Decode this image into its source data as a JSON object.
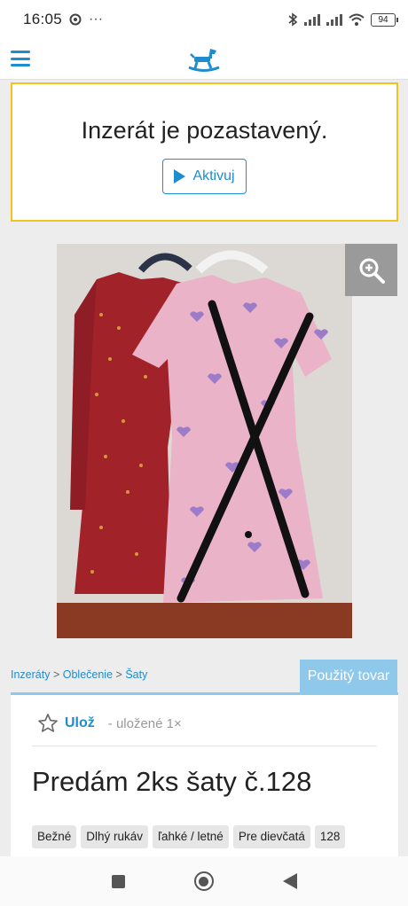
{
  "status": {
    "time": "16:05",
    "battery": "94"
  },
  "notice": {
    "title": "Inzerát je pozastavený.",
    "activate_label": "Aktivuj"
  },
  "breadcrumb": {
    "items": [
      "Inzeráty",
      "Oblečenie",
      "Šaty"
    ],
    "separator": ">"
  },
  "condition_tab": "Použitý tovar",
  "save": {
    "label": "Ulož",
    "count_text": "- uložené 1×"
  },
  "listing": {
    "title": "Predám 2ks šaty č.128",
    "tags": [
      "Bežné",
      "Dlhý rukáv",
      "ľahké / letné",
      "Pre dievčatá",
      "128"
    ]
  },
  "colors": {
    "accent": "#1e8ccf",
    "notice_border": "#f2c31a",
    "tab": "#8ec8ea"
  }
}
